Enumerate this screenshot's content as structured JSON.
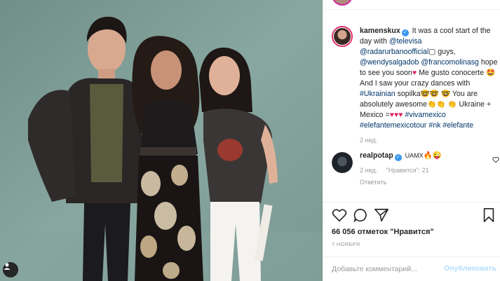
{
  "photo": {
    "description_icon": "person-tag-icon",
    "background_color": "#7d9a94"
  },
  "caption": {
    "username": "kamenskux",
    "verified": true,
    "text_parts": {
      "intro": "It was a cool start of the day with",
      "mention1": "@televisa",
      "mention2": "@radarurbanoofficial",
      "guys": "guys,",
      "mention3": "@wendysalgadob",
      "mention4": "@francomolinasg",
      "line3": "hope to see you soon",
      "line3b": "Me gusto conocerte",
      "line4": "And I saw your crazy dances with",
      "hashtag1": "#Ukrainian",
      "sopilka": "sopilka",
      "line5": "You are absolutely awesome",
      "line6": "Ukraine + Mexico =",
      "hashtags": "#vivamexico #elefantemexicotour #nk #elefante"
    },
    "time": "2 нед."
  },
  "reply_comment": {
    "username": "realpotap",
    "verified": true,
    "text": "UAMX",
    "time": "2 нед.",
    "likes": "\"Нравится\": 21",
    "reply_label": "Ответить"
  },
  "likes_text": "66 056 отметок \"Нравится\"",
  "date_text": "7 ноября",
  "add_comment": {
    "placeholder": "Добавьте комментарий...",
    "post_label": "Опубликовать"
  },
  "colors": {
    "link": "#003569",
    "verified": "#3897f0",
    "post_disabled": "#b2dffc",
    "heart": "#ed4956"
  }
}
